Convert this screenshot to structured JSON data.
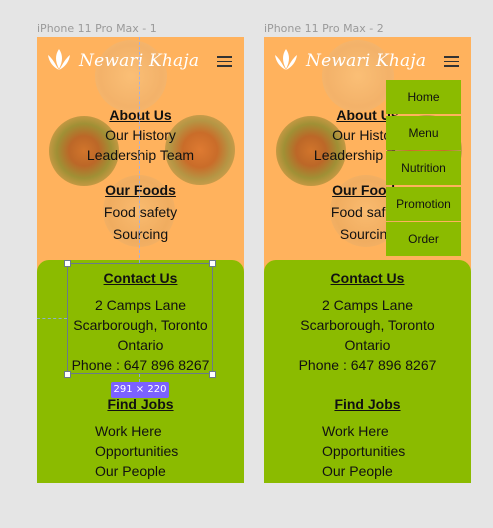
{
  "frames": [
    {
      "label": "iPhone 11 Pro Max - 1",
      "brand": "Newari Khaja",
      "about": {
        "title": "About Us",
        "items": [
          "Our History",
          "Leadership Team"
        ]
      },
      "foods": {
        "title": "Our Foods",
        "items": [
          "Food safety",
          "Sourcing"
        ]
      },
      "contact": {
        "title": "Contact Us",
        "lines": [
          "2 Camps Lane",
          "Scarborough, Toronto",
          "Ontario",
          "Phone : 647 896 8267"
        ]
      },
      "jobs": {
        "title": "Find Jobs",
        "items": [
          "Work Here",
          "Opportunities",
          "Our People"
        ]
      }
    },
    {
      "label": "iPhone 11 Pro Max - 2",
      "brand": "Newari Khaja",
      "about": {
        "title": "About Us",
        "items": [
          "Our History",
          "Leadership Team"
        ]
      },
      "foods": {
        "title": "Our Foods",
        "items": [
          "Food safety",
          "Sourcing"
        ]
      },
      "contact": {
        "title": "Contact Us",
        "lines": [
          "2 Camps Lane",
          "Scarborough, Toronto",
          "Ontario",
          "Phone : 647 896 8267"
        ]
      },
      "jobs": {
        "title": "Find Jobs",
        "items": [
          "Work Here",
          "Opportunities",
          "Our People"
        ]
      }
    }
  ],
  "nav_menu": [
    "Home",
    "Menu",
    "Nutrition",
    "Promotion",
    "Order"
  ],
  "selection": {
    "size_label": "291 × 220"
  },
  "colors": {
    "orange": "#ffb25d",
    "green": "#8bbb00",
    "selection": "#7b61ff"
  }
}
